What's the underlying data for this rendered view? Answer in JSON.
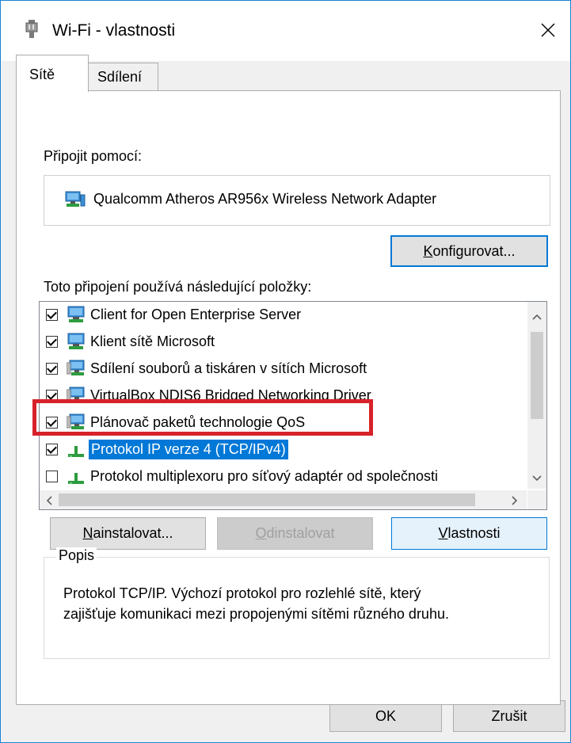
{
  "window": {
    "title": "Wi-Fi - vlastnosti"
  },
  "tabs": [
    {
      "label": "Sítě",
      "active": true
    },
    {
      "label": "Sdílení",
      "active": false
    }
  ],
  "connect_using": {
    "label": "Připojit pomocí:",
    "adapter": "Qualcomm Atheros AR956x Wireless Network Adapter",
    "configure_button": {
      "pre": "",
      "key": "K",
      "post": "onfigurovat..."
    }
  },
  "items_section": {
    "label_pre": "Toto připo",
    "label_key": "j",
    "label_post": "ení používá následující položky:"
  },
  "items": [
    {
      "label": "Client for Open Enterprise Server",
      "checked": true,
      "icon": "network-client-icon"
    },
    {
      "label": "Klient sítě Microsoft",
      "checked": true,
      "icon": "network-client-icon"
    },
    {
      "label": "Sdílení souborů a tiskáren v sítích Microsoft",
      "checked": true,
      "icon": "network-service-icon"
    },
    {
      "label": "VirtualBox NDIS6 Bridged Networking Driver",
      "checked": true,
      "icon": "network-service-icon"
    },
    {
      "label": "Plánovač paketů technologie QoS",
      "checked": true,
      "icon": "network-service-icon"
    },
    {
      "label": "Protokol IP verze 4 (TCP/IPv4)",
      "checked": true,
      "icon": "protocol-icon",
      "selected": true
    },
    {
      "label": "Protokol multiplexoru pro síťový adaptér od společnosti",
      "checked": false,
      "icon": "protocol-icon"
    }
  ],
  "buttons": {
    "install": {
      "key": "N",
      "post": "ainstalovat..."
    },
    "uninstall": {
      "key": "O",
      "post": "dinstalovat",
      "disabled": true
    },
    "properties": {
      "key": "V",
      "post": "lastnosti"
    }
  },
  "description": {
    "legend": "Popis",
    "line1": "Protokol TCP/IP. Výchozí protokol pro rozlehlé sítě, který",
    "line2": "zajišťuje komunikaci mezi propojenými sítěmi různého druhu."
  },
  "footer": {
    "ok": "OK",
    "cancel": "Zrušit"
  },
  "colors": {
    "selection": "#0078d7",
    "highlight_box": "#d7222a",
    "focus": "#0078d7"
  }
}
